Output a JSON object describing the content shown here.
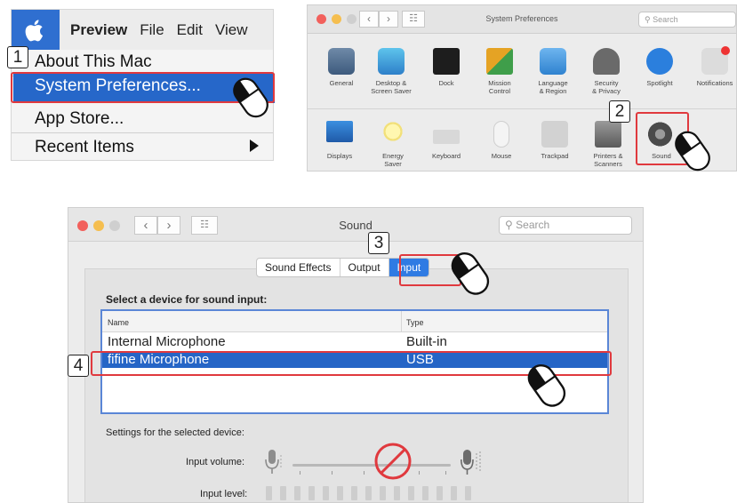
{
  "steps": [
    "1",
    "2",
    "3",
    "4"
  ],
  "apple_menu": {
    "menubar": [
      "Preview",
      "File",
      "Edit",
      "View"
    ],
    "items": [
      "About This Mac",
      "System Preferences...",
      "App Store...",
      "Recent Items"
    ]
  },
  "system_preferences": {
    "title": "System Preferences",
    "search_placeholder": "Search",
    "row1": [
      "General",
      "Desktop &\nScreen Saver",
      "Dock",
      "Mission\nControl",
      "Language\n& Region",
      "Security\n& Privacy",
      "Spotlight",
      "Notifications"
    ],
    "row2": [
      "Displays",
      "Energy\nSaver",
      "Keyboard",
      "Mouse",
      "Trackpad",
      "Printers &\nScanners",
      "Sound"
    ]
  },
  "sound": {
    "title": "Sound",
    "search_placeholder": "Search",
    "tabs": [
      "Sound Effects",
      "Output",
      "Input"
    ],
    "active_tab": "Input",
    "select_label": "Select a device for sound input:",
    "columns": [
      "Name",
      "Type"
    ],
    "devices": [
      {
        "name": "Internal Microphone",
        "type": "Built-in"
      },
      {
        "name": "fifine Microphone",
        "type": "USB"
      }
    ],
    "selected_device": "fifine Microphone",
    "settings_label": "Settings for the selected device:",
    "input_volume_label": "Input volume:",
    "input_level_label": "Input level:"
  },
  "colors": {
    "highlight": "#2565c6",
    "callout": "#e0393e",
    "apple_blue": "#2f6fd0"
  }
}
